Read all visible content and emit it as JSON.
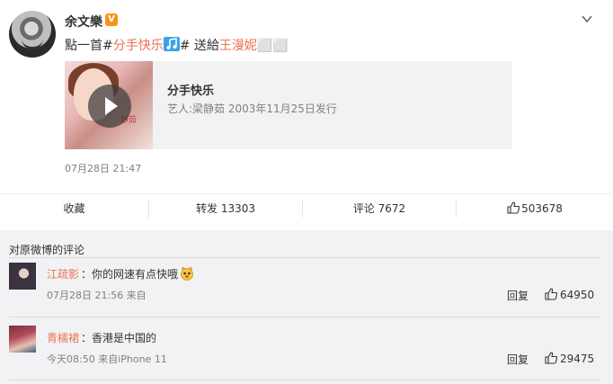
{
  "post": {
    "username": "余文樂",
    "verified_badge": "V",
    "text_prefix": "點一首#",
    "hashtag": "分手快乐",
    "text_after_hashtag": "# 送給",
    "mention": "王漫妮",
    "text_suffix": "⬜⬜",
    "time": "07月28日 21:47"
  },
  "music": {
    "title": "分手快乐",
    "meta": "艺人:梁静茹 2003年11月25日发行",
    "cover_tag": "靜茹"
  },
  "actions": {
    "favorite": "收藏",
    "repost": "转发 13303",
    "comment": "评论 7672",
    "like": "503678"
  },
  "comments": {
    "section_title": "对原微博的评论",
    "items": [
      {
        "name": "江疏影",
        "text": "你的网速有点快哦",
        "meta": "07月28日 21:56 来自",
        "reply": "回复",
        "likes": "64950",
        "emoji": "cat-face-icon"
      },
      {
        "name": "青檽裙",
        "text": "香港是中国的",
        "meta": "今天08:50 来自iPhone 11",
        "reply": "回复",
        "likes": "29475"
      }
    ]
  },
  "colors": {
    "accent": "#eb7350",
    "link": "#eb7350",
    "panel": "#f2f2f5",
    "muted": "#808080"
  }
}
